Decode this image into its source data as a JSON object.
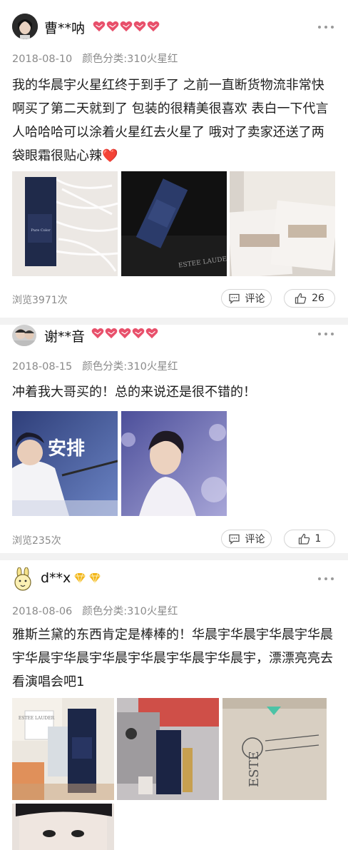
{
  "reviews": [
    {
      "username": "曹**呐",
      "badge_icon": "heart-badge-icon",
      "badge_count": 5,
      "date": "2018-08-10",
      "color_label": "颜色分类:310火星红",
      "text": "我的华晨宇火星红终于到手了 之前一直断货物流非常快啊买了第二天就到了 包装的很精美很喜欢 表白一下代言人哈哈哈可以涂着火星红去火星了 哦对了卖家还送了两袋眼霜很贴心辣",
      "text_emoji": "❤️",
      "views": "浏览3971次",
      "comment_label": "评论",
      "likes": "26"
    },
    {
      "username": "谢**音",
      "badge_icon": "heart-badge-icon",
      "badge_count": 5,
      "date": "2018-08-15",
      "color_label": "颜色分类:310火星红",
      "text": "冲着我大哥买的！总的来说还是很不错的！",
      "photo_caption": "安排",
      "views": "浏览235次",
      "comment_label": "评论",
      "likes": "1"
    },
    {
      "username": "d**x",
      "badge_icon": "diamond-badge-icon",
      "badge_count": 2,
      "date": "2018-08-06",
      "color_label": "颜色分类:310火星红",
      "text": "雅斯兰黛的东西肯定是棒棒的！华晨宇华晨宇华晨宇华晨宇华晨宇华晨宇华晨宇华晨宇华晨宇华晨宇，漂漂亮亮去看演唱会吧1"
    }
  ],
  "colors": {
    "heart": "#e8506b",
    "diamond": "#f2b519",
    "emoji_heart": "#e0242c"
  }
}
